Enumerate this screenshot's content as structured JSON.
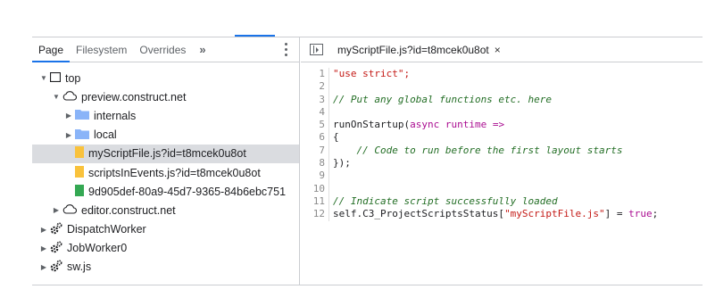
{
  "left_panel": {
    "tabs": [
      {
        "label": "Page",
        "active": true
      },
      {
        "label": "Filesystem",
        "active": false
      },
      {
        "label": "Overrides",
        "active": false
      }
    ],
    "more_label": "»",
    "tree": [
      {
        "label": "top",
        "icon": "frame-icon",
        "expanded": true,
        "selected": false
      },
      {
        "label": "preview.construct.net",
        "icon": "cloud-icon",
        "expanded": true,
        "selected": false
      },
      {
        "label": "internals",
        "icon": "folder-icon",
        "expanded": false,
        "selected": false
      },
      {
        "label": "local",
        "icon": "folder-icon",
        "expanded": false,
        "selected": false
      },
      {
        "label": "myScriptFile.js?id=t8mcek0u8ot",
        "icon": "script-file-icon",
        "selected": true
      },
      {
        "label": "scriptsInEvents.js?id=t8mcek0u8ot",
        "icon": "script-file-icon",
        "selected": false
      },
      {
        "label": "9d905def-80a9-45d7-9365-84b6ebc751",
        "icon": "document-file-icon",
        "selected": false
      },
      {
        "label": "editor.construct.net",
        "icon": "cloud-icon",
        "expanded": false,
        "selected": false
      },
      {
        "label": "DispatchWorker",
        "icon": "gear-icon",
        "expanded": false,
        "selected": false
      },
      {
        "label": "JobWorker0",
        "icon": "gear-icon",
        "expanded": false,
        "selected": false
      },
      {
        "label": "sw.js",
        "icon": "gear-icon",
        "expanded": false,
        "selected": false
      }
    ]
  },
  "editor": {
    "file_tab": "myScriptFile.js?id=t8mcek0u8ot",
    "close_label": "×",
    "lines": [
      {
        "n": "1",
        "text": "\"use strict\";"
      },
      {
        "n": "2",
        "text": ""
      },
      {
        "n": "3",
        "text": "// Put any global functions etc. here"
      },
      {
        "n": "4",
        "text": ""
      },
      {
        "n": "5",
        "text": "runOnStartup(async runtime =>"
      },
      {
        "n": "6",
        "text": "{"
      },
      {
        "n": "7",
        "text": "    // Code to run before the first layout starts"
      },
      {
        "n": "8",
        "text": "});"
      },
      {
        "n": "9",
        "text": ""
      },
      {
        "n": "10",
        "text": ""
      },
      {
        "n": "11",
        "text": "// Indicate script successfully loaded"
      },
      {
        "n": "12",
        "text": "self.C3_ProjectScriptsStatus[\"myScriptFile.js\"] = true;"
      }
    ]
  },
  "colors": {
    "accent": "#1a73e8",
    "folder": "#8ab4f8",
    "script_file": "#f9c23c",
    "document_file": "#34a853",
    "selected_row": "#dadce0"
  }
}
